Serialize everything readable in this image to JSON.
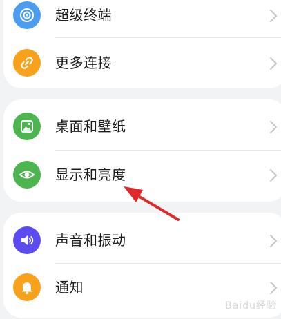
{
  "settings": {
    "group1": [
      {
        "label": "超级终端",
        "icon": "super-device-icon",
        "color": "#4a9df1"
      },
      {
        "label": "更多连接",
        "icon": "link-icon",
        "color": "#f7a21a"
      }
    ],
    "group2": [
      {
        "label": "桌面和壁纸",
        "icon": "wallpaper-icon",
        "color": "#4cb54f"
      },
      {
        "label": "显示和亮度",
        "icon": "eye-icon",
        "color": "#4cb54f"
      }
    ],
    "group3": [
      {
        "label": "声音和振动",
        "icon": "speaker-icon",
        "color": "#5c4bf0"
      },
      {
        "label": "通知",
        "icon": "bell-icon",
        "color": "#f7a21a"
      }
    ]
  },
  "annotation": {
    "color": "#e02a2a"
  },
  "watermark": "Baidu经验"
}
